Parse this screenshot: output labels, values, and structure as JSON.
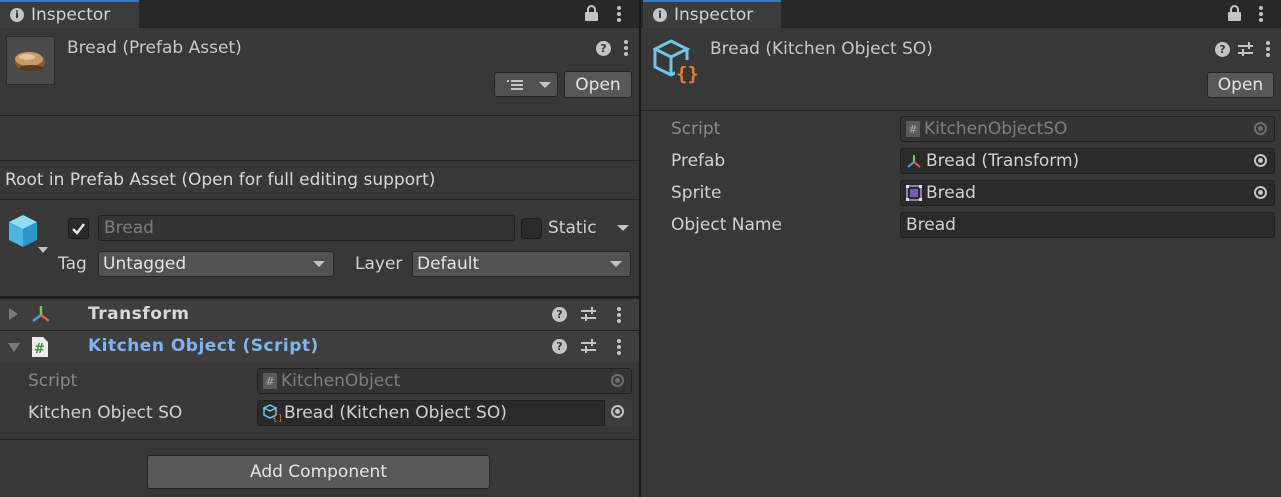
{
  "left_panel": {
    "tab_title": "Inspector",
    "asset_title": "Bread (Prefab Asset)",
    "open_button": "Open",
    "root_notice": "Root in Prefab Asset (Open for full editing support)",
    "object_name": "Bread",
    "static_label": "Static",
    "tag_label": "Tag",
    "tag_value": "Untagged",
    "layer_label": "Layer",
    "layer_value": "Default",
    "components": [
      {
        "title": "Transform",
        "expanded": false
      },
      {
        "title": "Kitchen Object (Script)",
        "expanded": true
      }
    ],
    "script_label": "Script",
    "script_value": "KitchenObject",
    "so_label": "Kitchen Object SO",
    "so_value": "Bread (Kitchen Object SO)",
    "add_component": "Add Component"
  },
  "right_panel": {
    "tab_title": "Inspector",
    "asset_title": "Bread (Kitchen Object SO)",
    "open_button": "Open",
    "fields": {
      "script_label": "Script",
      "script_value": "KitchenObjectSO",
      "prefab_label": "Prefab",
      "prefab_value": "Bread (Transform)",
      "sprite_label": "Sprite",
      "sprite_value": "Bread",
      "object_name_label": "Object Name",
      "object_name_value": "Bread"
    }
  },
  "colors": {
    "panel_bg": "#383838",
    "tab_accent": "#3a79bb",
    "script_title": "#7fb4f0",
    "so_icon_orange": "#f07a2a",
    "so_icon_cyan": "#6fc6e8"
  },
  "icons": {
    "info": "info-icon",
    "lock": "lock-icon",
    "menu": "kebab-menu-icon",
    "help": "help-icon",
    "preset": "sliders-icon",
    "gameobject": "cube-icon",
    "transform": "transform-axes-icon",
    "script": "script-hash-icon",
    "scriptable_object": "scriptable-object-icon"
  }
}
